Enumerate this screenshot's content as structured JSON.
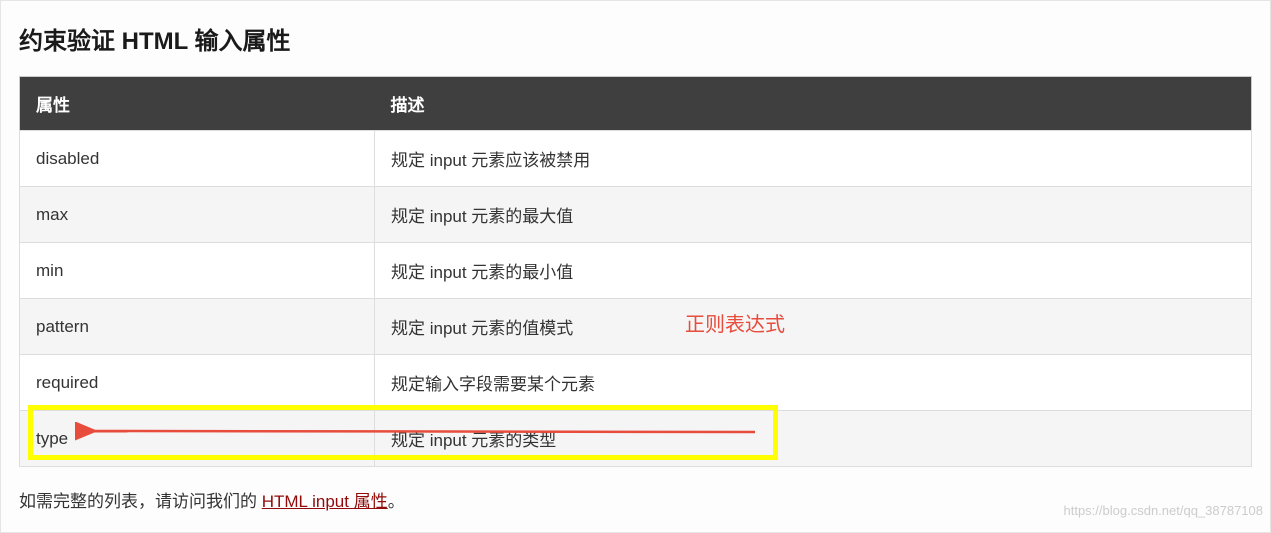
{
  "heading": "约束验证 HTML 输入属性",
  "table": {
    "headers": [
      "属性",
      "描述"
    ],
    "rows": [
      {
        "attr": "disabled",
        "desc": "规定 input 元素应该被禁用"
      },
      {
        "attr": "max",
        "desc": "规定 input 元素的最大值"
      },
      {
        "attr": "min",
        "desc": "规定 input 元素的最小值"
      },
      {
        "attr": "pattern",
        "desc": "规定 input 元素的值模式"
      },
      {
        "attr": "required",
        "desc": "规定输入字段需要某个元素"
      },
      {
        "attr": "type",
        "desc": "规定 input 元素的类型"
      }
    ]
  },
  "annotation": "正则表达式",
  "footer": {
    "prefix": "如需完整的列表，请访问我们的 ",
    "link_text": "HTML input 属性",
    "suffix": "。"
  },
  "watermark": "https://blog.csdn.net/qq_38787108"
}
